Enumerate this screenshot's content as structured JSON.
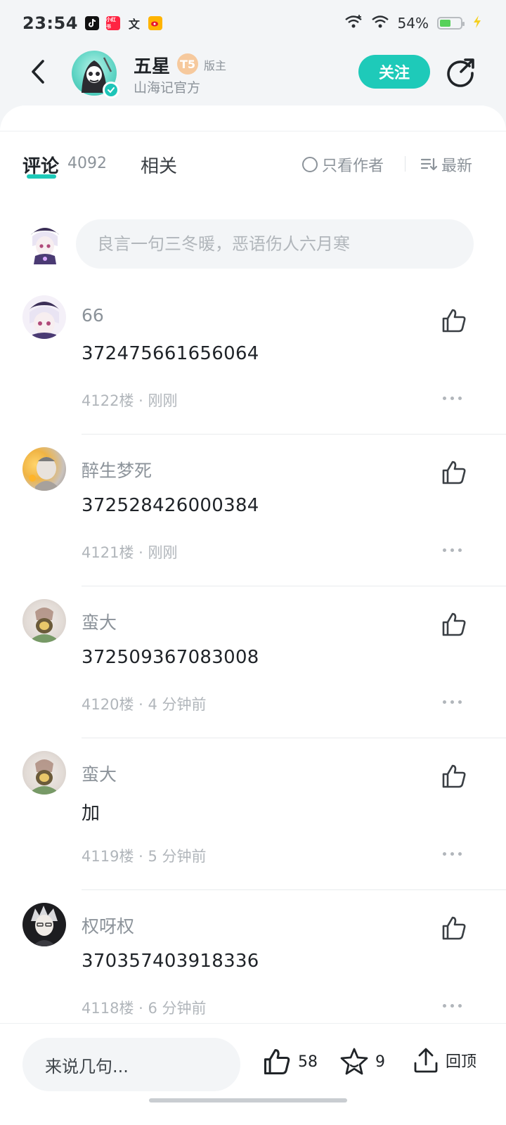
{
  "status_bar": {
    "time": "23:54",
    "app_icons": [
      "tiktok-icon",
      "xiaohongshu-icon",
      "translate-icon",
      "weibo-icon"
    ],
    "xiaohongshu_text": "小红书",
    "battery": "54%",
    "battery_level": 0.54
  },
  "header": {
    "name": "五星",
    "level": "T5",
    "role": "版主",
    "subtitle": "山海记官方",
    "follow_label": "关注"
  },
  "tabs": {
    "comments_label": "评论",
    "comments_count": "4092",
    "related_label": "相关",
    "only_author_label": "只看作者",
    "sort_label": "最新"
  },
  "composer": {
    "placeholder": "良言一句三冬暖，恶语伤人六月寒"
  },
  "comments": [
    {
      "name": "66",
      "text": "372475661656064",
      "meta": "4122楼 · 刚刚"
    },
    {
      "name": "醉生梦死",
      "text": "372528426000384",
      "meta": "4121楼 · 刚刚"
    },
    {
      "name": "蛮大",
      "text": "372509367083008",
      "meta": "4120楼 · 4 分钟前"
    },
    {
      "name": "蛮大",
      "text": "加",
      "meta": "4119楼 · 5 分钟前"
    },
    {
      "name": "权呀权",
      "text": "370357403918336",
      "meta": "4118楼 · 6 分钟前"
    }
  ],
  "bottom_bar": {
    "reply_placeholder": "来说几句...",
    "likes": "58",
    "favorites": "9",
    "back_to_top": "回顶"
  },
  "colors": {
    "accent": "#1ecab9",
    "text_primary": "#1f2328",
    "text_secondary": "#8c939a"
  }
}
